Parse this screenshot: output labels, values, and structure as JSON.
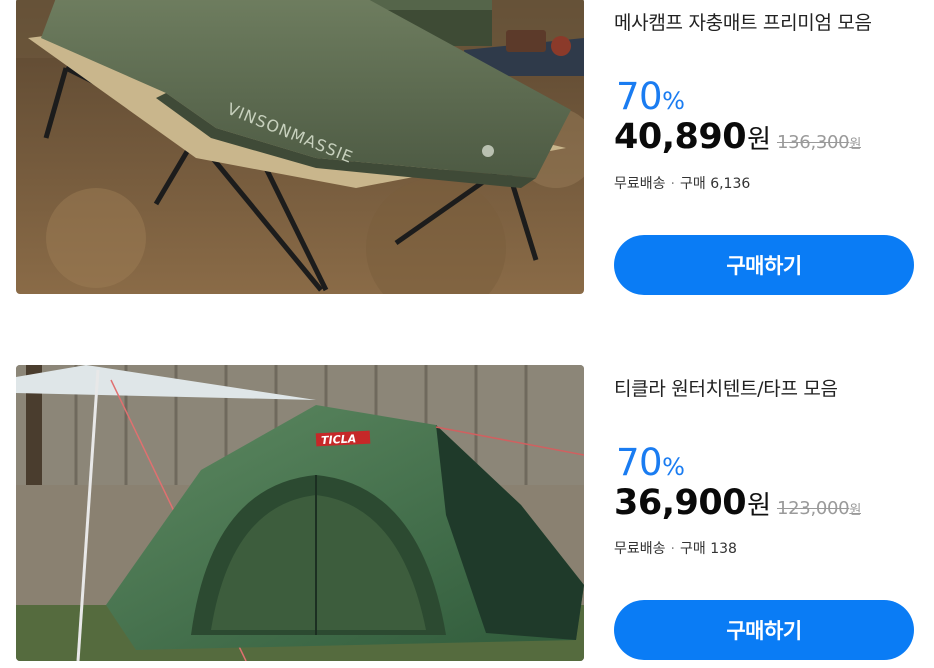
{
  "products": [
    {
      "title": "메사캠프 자충매트 프리미엄 모음",
      "discount": "70",
      "discount_unit": "%",
      "price": "40,890",
      "price_unit": "원",
      "original_price": "136,300",
      "original_unit": "원",
      "shipping": "무료배송",
      "separator": "·",
      "purchases": "구매 6,136",
      "buy_label": "구매하기",
      "image_brand_text": "VINSONMASSIE"
    },
    {
      "title": "티클라 원터치텐트/타프 모음",
      "discount": "70",
      "discount_unit": "%",
      "price": "36,900",
      "price_unit": "원",
      "original_price": "123,000",
      "original_unit": "원",
      "shipping": "무료배송",
      "separator": "·",
      "purchases": "구매 138",
      "buy_label": "구매하기",
      "image_brand_text": "TICLA"
    }
  ],
  "colors": {
    "accent": "#0a7cf5",
    "discount": "#1a7cf1",
    "strike": "#9a9a9a"
  }
}
